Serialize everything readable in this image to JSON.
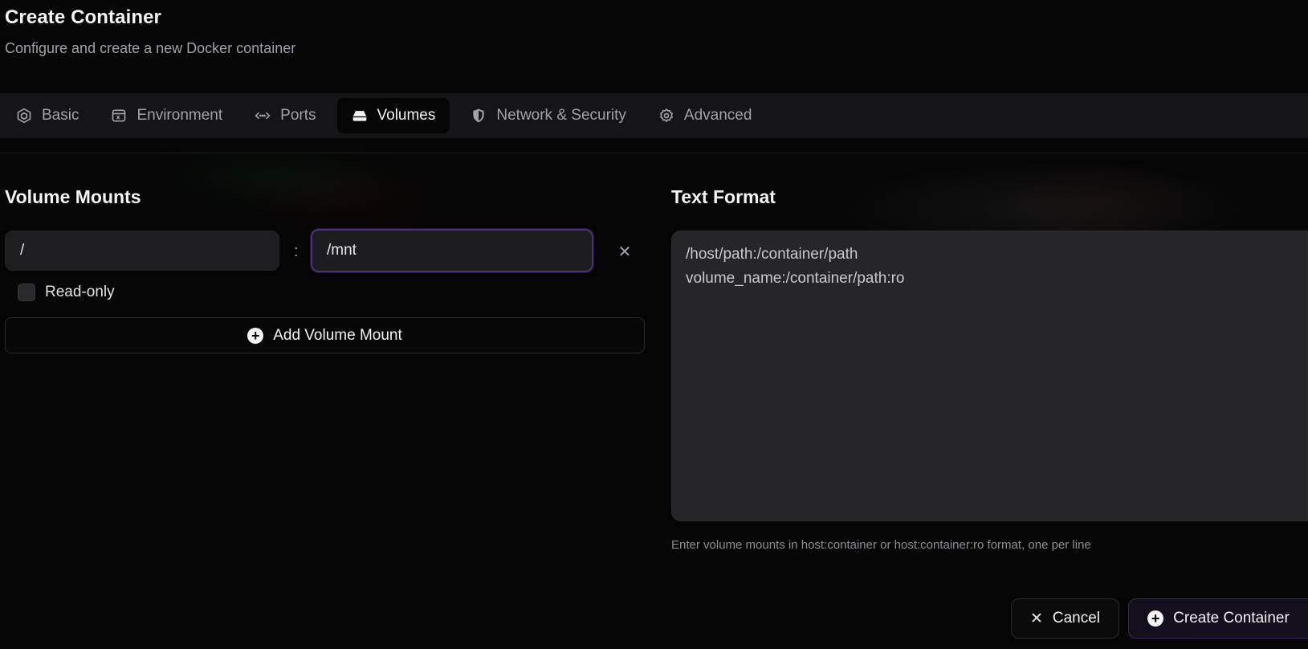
{
  "header": {
    "title": "Create Container",
    "subtitle": "Configure and create a new Docker container"
  },
  "tabs": [
    {
      "label": "Basic",
      "icon": "package-icon",
      "active": false
    },
    {
      "label": "Environment",
      "icon": "variable-icon",
      "active": false
    },
    {
      "label": "Ports",
      "icon": "ports-icon",
      "active": false
    },
    {
      "label": "Volumes",
      "icon": "hard-drive-icon",
      "active": true
    },
    {
      "label": "Network & Security",
      "icon": "shield-icon",
      "active": false
    },
    {
      "label": "Advanced",
      "icon": "gear-icon",
      "active": false
    }
  ],
  "volume_mounts": {
    "title": "Volume Mounts",
    "mount": {
      "host_value": "/",
      "separator": ":",
      "container_value": "/mnt",
      "remove_icon": "close-icon",
      "read_only_label": "Read-only",
      "read_only_checked": false
    },
    "add_button_label": "Add Volume Mount"
  },
  "text_format": {
    "title": "Text Format",
    "placeholder": "/host/path:/container/path\nvolume_name:/container/path:ro",
    "helper": "Enter volume mounts in host:container or host:container:ro format, one per line"
  },
  "footer": {
    "cancel_label": "Cancel",
    "create_label": "Create Container"
  },
  "colors": {
    "background": "#050505",
    "tabbar": "#151517",
    "input": "#1e1e20",
    "focus_ring": "#4c2f7a",
    "primary_border": "#3b2a5e"
  }
}
